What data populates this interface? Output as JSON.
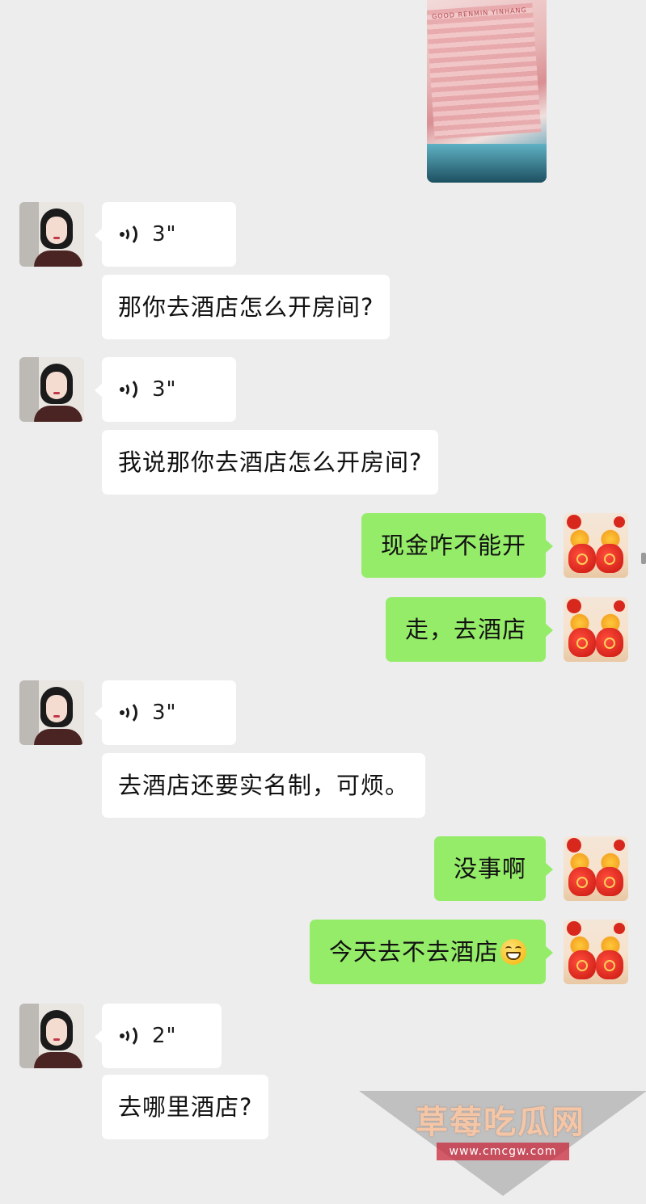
{
  "photo": {
    "label": "photo-message",
    "bill_text": "GOOD RENMIN YINHANG"
  },
  "messages": [
    {
      "side": "left",
      "type": "voice",
      "duration": "3\""
    },
    {
      "side": "left",
      "type": "text",
      "text": "那你去酒店怎么开房间?"
    },
    {
      "side": "left",
      "type": "voice",
      "duration": "3\""
    },
    {
      "side": "left",
      "type": "text",
      "text": "我说那你去酒店怎么开房间?"
    },
    {
      "side": "right",
      "type": "text",
      "text": "现金咋不能开"
    },
    {
      "side": "right",
      "type": "text",
      "text": "走，去酒店"
    },
    {
      "side": "left",
      "type": "voice",
      "duration": "3\""
    },
    {
      "side": "left",
      "type": "text",
      "text": "去酒店还要实名制，可烦。"
    },
    {
      "side": "right",
      "type": "text",
      "text": "没事啊"
    },
    {
      "side": "right",
      "type": "text",
      "text": "今天去不去酒店",
      "emoji": "grinning-face-icon"
    },
    {
      "side": "left",
      "type": "voice",
      "duration": "2\""
    },
    {
      "side": "left",
      "type": "text",
      "text": "去哪里酒店?"
    }
  ],
  "watermark": {
    "title": "草莓吃瓜网",
    "url": "www.cmcgw.com"
  },
  "colors": {
    "background": "#ededed",
    "incoming_bubble": "#ffffff",
    "outgoing_bubble": "#95ec69"
  }
}
